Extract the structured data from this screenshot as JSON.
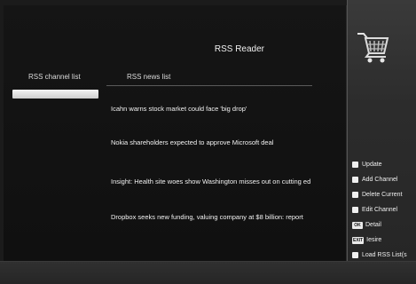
{
  "header": {
    "title": "RSS Reader",
    "icon": "shopping-cart-icon"
  },
  "columns": {
    "channel_list": "RSS channel list",
    "news_list": "RSS news list"
  },
  "channels": [
    {
      "label": "",
      "selected": true
    }
  ],
  "news": [
    "Icahn warns stock market could face 'big drop'",
    "Nokia shareholders expected to approve Microsoft deal",
    "Insight: Health site woes show Washington misses out on cutting ed",
    "Dropbox seeks new funding, valuing company at $8 billion: report"
  ],
  "menu": [
    {
      "key_type": "square",
      "key": "",
      "label": "Update"
    },
    {
      "key_type": "square",
      "key": "",
      "label": "Add Channel"
    },
    {
      "key_type": "square",
      "key": "",
      "label": "Delete Current"
    },
    {
      "key_type": "square",
      "key": "",
      "label": "Edit Channel"
    },
    {
      "key_type": "key",
      "key": "OK",
      "label": "Detail"
    },
    {
      "key_type": "key",
      "key": "EXIT",
      "label": "Iesire"
    },
    {
      "key_type": "square",
      "key": "",
      "label": "Load RSS List(s"
    }
  ]
}
